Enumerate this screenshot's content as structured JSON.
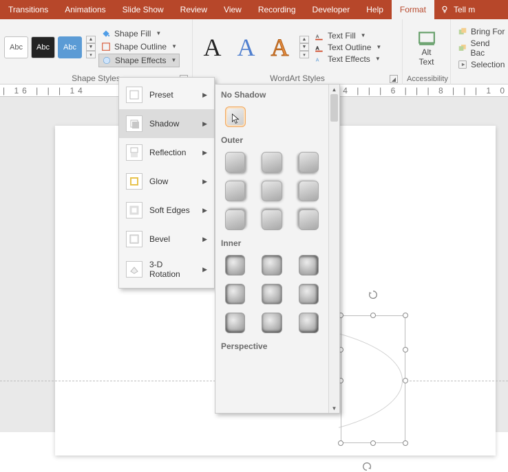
{
  "tabs": [
    "Transitions",
    "Animations",
    "Slide Show",
    "Review",
    "View",
    "Recording",
    "Developer",
    "Help",
    "Format"
  ],
  "active_tab": "Format",
  "tell_me": "Tell m",
  "shape_styles": {
    "abc": "Abc",
    "label": "Shape Styles"
  },
  "shape_btns": {
    "fill": "Shape Fill",
    "outline": "Shape Outline",
    "effects": "Shape Effects"
  },
  "wordart": {
    "label": "WordArt Styles",
    "fill": "Text Fill",
    "outline": "Text Outline",
    "effects": "Text Effects"
  },
  "accessibility": {
    "label": "Accessibility",
    "alt1": "Alt",
    "alt2": "Text"
  },
  "arrange": {
    "bring": "Bring For",
    "send": "Send Bac",
    "selection": "Selection"
  },
  "ruler_left": "| 16 | | | 14",
  "ruler_right": "| | 2 | | | 4 | | | 6 | | | 8 | | | 1 0",
  "effects_menu": [
    {
      "key": "preset",
      "label": "Preset"
    },
    {
      "key": "shadow",
      "label": "Shadow"
    },
    {
      "key": "reflection",
      "label": "Reflection"
    },
    {
      "key": "glow",
      "label": "Glow"
    },
    {
      "key": "soft-edges",
      "label": "Soft Edges"
    },
    {
      "key": "bevel",
      "label": "Bevel"
    },
    {
      "key": "3d-rotation",
      "label": "3-D Rotation"
    }
  ],
  "shadow_panel": {
    "no_shadow": "No Shadow",
    "outer": "Outer",
    "inner": "Inner",
    "perspective": "Perspective"
  }
}
